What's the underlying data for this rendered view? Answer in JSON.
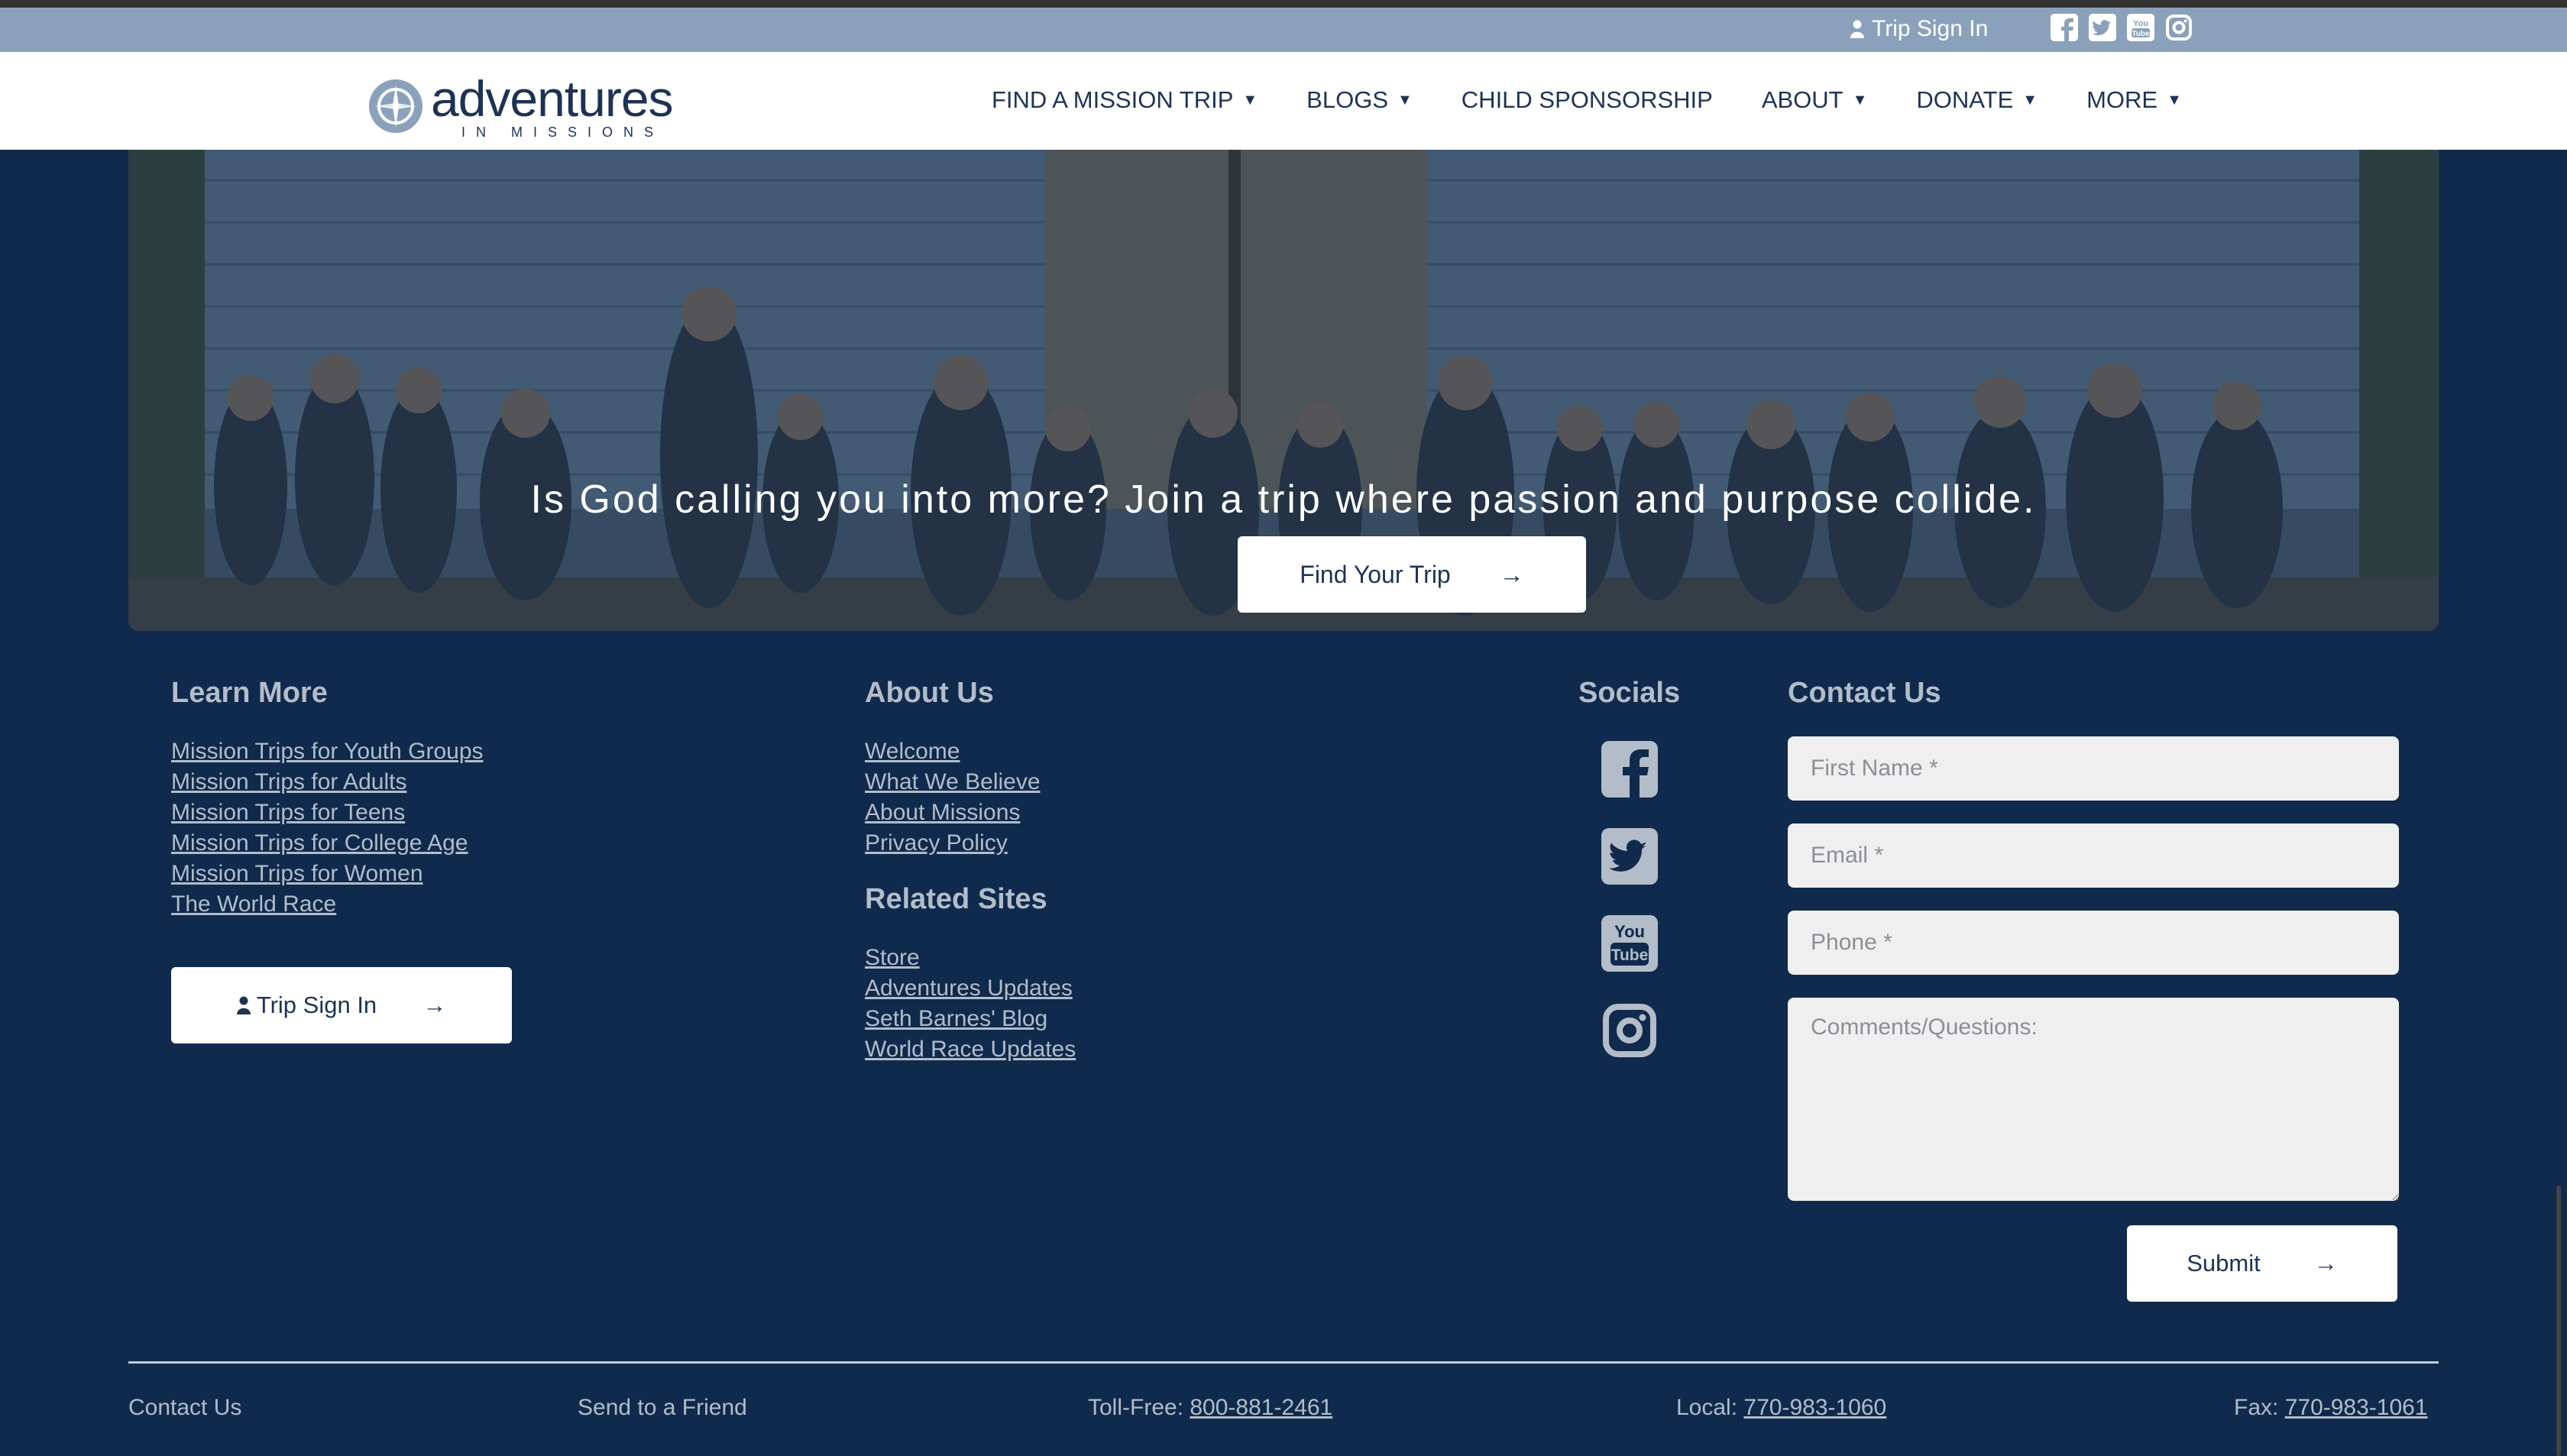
{
  "utility_bar": {
    "sign_in_label": "Trip Sign In",
    "social_icons": [
      "facebook-icon",
      "twitter-icon",
      "youtube-icon",
      "instagram-icon"
    ]
  },
  "logo": {
    "main": "adventures",
    "sub": "IN MISSIONS"
  },
  "nav": {
    "items": [
      {
        "label": "FIND A MISSION TRIP",
        "has_dropdown": true
      },
      {
        "label": "BLOGS",
        "has_dropdown": true
      },
      {
        "label": "CHILD SPONSORSHIP",
        "has_dropdown": false
      },
      {
        "label": "ABOUT",
        "has_dropdown": true
      },
      {
        "label": "DONATE",
        "has_dropdown": true
      },
      {
        "label": "MORE",
        "has_dropdown": true
      }
    ]
  },
  "hero": {
    "headline": "Is God calling you into more? Join a trip where passion and purpose collide.",
    "button_label": "Find Your Trip",
    "arrow": "→"
  },
  "learn_more": {
    "heading": "Learn More",
    "links": [
      "Mission Trips for Youth Groups",
      "Mission Trips for Adults",
      "Mission Trips for Teens",
      "Mission Trips for College Age",
      "Mission Trips for Women",
      "The World Race"
    ],
    "signin_button": "Trip Sign In",
    "arrow": "→"
  },
  "about_us": {
    "heading": "About Us",
    "links": [
      "Welcome",
      "What We Believe",
      "About Missions",
      "Privacy Policy"
    ]
  },
  "related_sites": {
    "heading": "Related Sites",
    "links": [
      "Store",
      "Adventures Updates",
      "Seth Barnes' Blog",
      "World Race Updates"
    ]
  },
  "socials": {
    "heading": "Socials",
    "icons": [
      "facebook-icon",
      "twitter-icon",
      "youtube-icon",
      "instagram-icon"
    ]
  },
  "contact": {
    "heading": "Contact Us",
    "first_name_placeholder": "First Name *",
    "email_placeholder": "Email *",
    "phone_placeholder": "Phone *",
    "comments_placeholder": "Comments/Questions:",
    "submit_label": "Submit",
    "arrow": "→"
  },
  "bottom_bar": {
    "contact_link": "Contact Us",
    "send_link": "Send to a Friend",
    "toll_free_label": "Toll-Free:",
    "toll_free_number": "800-881-2461",
    "local_label": "Local:",
    "local_number": "770-983-1060",
    "fax_label": "Fax:",
    "fax_number": "770-983-1061"
  },
  "colors": {
    "footer_bg": "#0f2a4c",
    "utility_bar": "#8ba1bb",
    "text_muted": "#b3bcc9",
    "brand_navy": "#1d3354"
  }
}
